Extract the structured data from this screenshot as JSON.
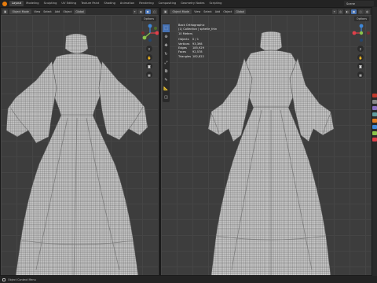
{
  "topbar": {
    "workspaces": [
      "Layout",
      "Modeling",
      "Sculpting",
      "UV Editing",
      "Texture Paint",
      "Shading",
      "Animation",
      "Rendering",
      "Compositing",
      "Geometry Nodes",
      "Scripting"
    ],
    "active_workspace": "Layout",
    "scene_name": "Scene"
  },
  "left_viewport": {
    "mode": "Object Mode",
    "menus": [
      "View",
      "Select",
      "Add",
      "Object"
    ],
    "transform_orientation": "Global",
    "options_label": "Options"
  },
  "right_viewport": {
    "mode": "Object Mode",
    "menus": [
      "View",
      "Select",
      "Add",
      "Object"
    ],
    "transform_orientation": "Global",
    "options_label": "Options",
    "overlay": {
      "view_name": "Back Orthographic",
      "collection": "(1) Collection | sphelle_thin",
      "scale": "10 Meters",
      "stats": [
        {
          "label": "Objects",
          "value": "0 / 1"
        },
        {
          "label": "Vertices",
          "value": "93,398"
        },
        {
          "label": "Edges",
          "value": "185,929"
        },
        {
          "label": "Faces",
          "value": "92,578"
        },
        {
          "label": "Triangles",
          "value": "182,822"
        }
      ]
    }
  },
  "statusbar": {
    "text": "Object Context Menu"
  },
  "colors": {
    "accent": "#4772b3",
    "logo": "#e87d0d",
    "viewport_bg": "#3d3d3d",
    "axis_x": "#e0404a",
    "axis_y": "#8bc34a",
    "axis_z": "#3e87d8"
  }
}
